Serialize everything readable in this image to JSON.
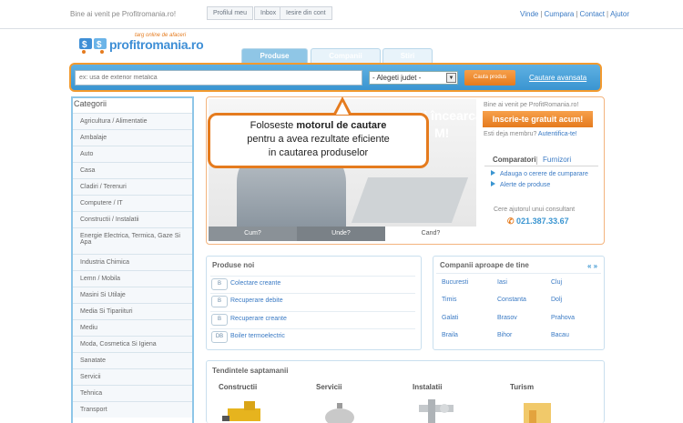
{
  "top": {
    "welcome": "Bine ai venit pe Profitromania.ro!",
    "account_buttons": [
      "Profilul meu",
      "Inbox",
      "Iesire din cont"
    ],
    "links": [
      "Vinde",
      "Cumpara",
      "Contact",
      "Ajutor"
    ]
  },
  "logo": {
    "tagline": "targ online de afaceri",
    "name": "profitromania.ro"
  },
  "tabs": [
    {
      "label": "Produse",
      "active": true
    },
    {
      "label": "Companii",
      "active": false
    },
    {
      "label": "Stiri",
      "active": false
    }
  ],
  "search": {
    "placeholder": "ex: usa de exterior metalica",
    "county_selected": "- Alegeti judet -",
    "button": "Cauta produs",
    "advanced": "Cautare avansata"
  },
  "categories": {
    "title": "Categorii",
    "items": [
      "Agricultura / Alimentatie",
      "Ambalaje",
      "Auto",
      "Casa",
      "Cladiri / Terenuri",
      "Computere / IT",
      "Constructii / Instalatii",
      "Energie Electrica, Termica, Gaze Si Apa",
      "Industria Chimica",
      "Lemn / Mobila",
      "Masini Si Utilaje",
      "Media Si Tipariituri",
      "Mediu",
      "Moda, Cosmetica Si Igiena",
      "Sanatate",
      "Servicii",
      "Tehnica",
      "Transport"
    ]
  },
  "hero": {
    "big_text_1": "uti încearcă bani",
    "big_text_2": "M!",
    "strip": [
      "Cum?",
      "Unde?",
      "Cand?"
    ]
  },
  "callout": {
    "line1_pre": "Foloseste ",
    "line1_bold": "motorul de cautare",
    "line2": "pentru a avea rezultate eficiente",
    "line3": "in cautarea produselor"
  },
  "panel": {
    "welcome": "Bine ai venit pe ProfitRomania.ro!",
    "register": "Inscrie-te gratuit acum!",
    "member_q": "Esti deja membru?",
    "member_link": "Autentifica-te!",
    "subtab_active": "Comparatori",
    "subtab_other": "Furnizori",
    "links": [
      "Adauga o cerere de cumparare",
      "Alerte de produse"
    ],
    "consult": "Cere ajutorul unui consultant",
    "phone": "021.387.33.67"
  },
  "products_new": {
    "title": "Produse noi",
    "items": [
      {
        "badge": "B",
        "label": "Colectare creante"
      },
      {
        "badge": "B",
        "label": "Recuperare debite"
      },
      {
        "badge": "B",
        "label": "Recuperare creante"
      },
      {
        "badge": "DB",
        "label": "Boiler termoelectric"
      }
    ]
  },
  "companies": {
    "title": "Companii aproape de tine",
    "nav": "« »",
    "cities": [
      [
        "Bucuresti",
        "Iasi",
        "Cluj"
      ],
      [
        "Timis",
        "Constanta",
        "Dolj"
      ],
      [
        "Galati",
        "Brasov",
        "Prahova"
      ],
      [
        "Braila",
        "Bihor",
        "Bacau"
      ]
    ]
  },
  "trends": {
    "title": "Tendintele saptamanii",
    "columns": [
      "Constructii",
      "Servicii",
      "Instalatii",
      "Turism"
    ]
  },
  "colors": {
    "accent_orange": "#e57b1e",
    "accent_blue": "#3a95d1",
    "link_blue": "#3a7ac4"
  }
}
